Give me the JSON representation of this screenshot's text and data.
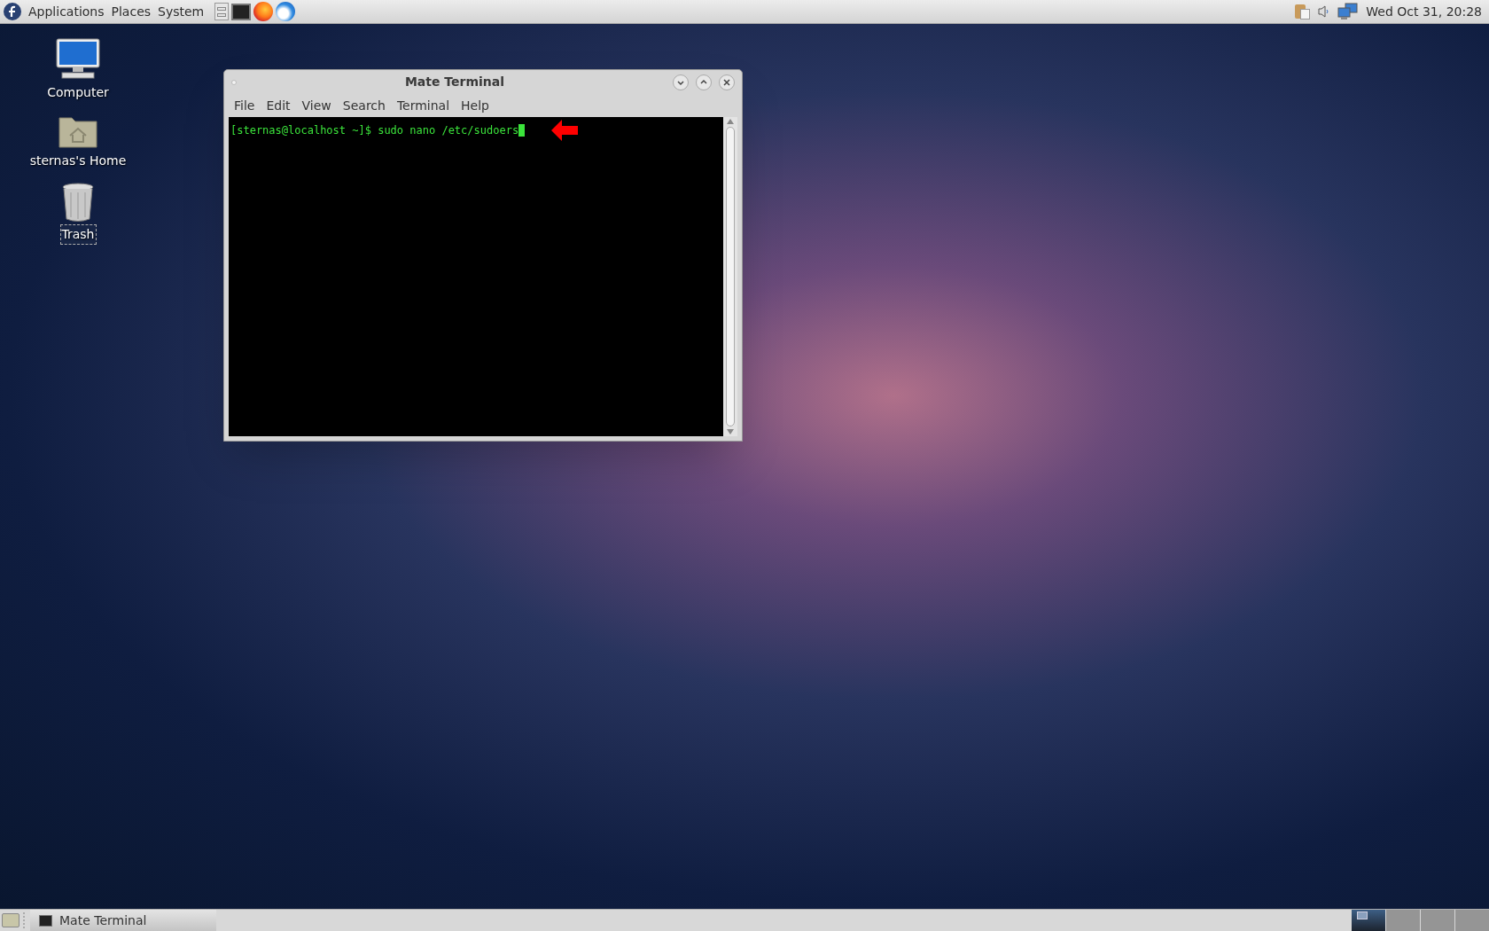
{
  "top_panel": {
    "menus": [
      "Applications",
      "Places",
      "System"
    ],
    "clock": "Wed Oct 31, 20:28"
  },
  "desktop_icons": [
    {
      "kind": "computer",
      "label": "Computer",
      "selected": false
    },
    {
      "kind": "home",
      "label": "sternas's Home",
      "selected": false
    },
    {
      "kind": "trash",
      "label": "Trash",
      "selected": true
    }
  ],
  "window": {
    "title": "Mate Terminal",
    "menu": [
      "File",
      "Edit",
      "View",
      "Search",
      "Terminal",
      "Help"
    ],
    "terminal_lines": [
      {
        "prompt": "[sternas@localhost ~]$ ",
        "command": "sudo nano /etc/sudoers",
        "cursor": true
      }
    ]
  },
  "bottom_panel": {
    "tasks": [
      {
        "label": "Mate Terminal",
        "selected": false
      }
    ],
    "workspaces": [
      {
        "selected": true
      },
      {
        "selected": false
      },
      {
        "selected": false
      },
      {
        "selected": false
      }
    ]
  }
}
